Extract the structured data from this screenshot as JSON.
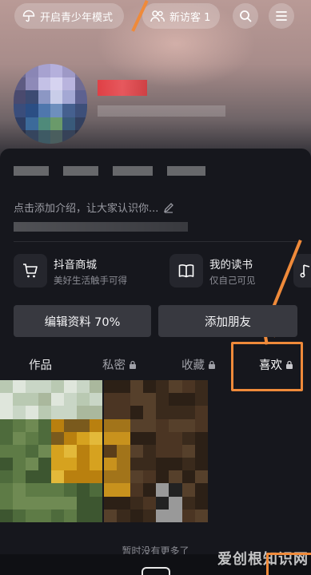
{
  "header": {
    "teen_mode_label": "开启青少年模式",
    "visitor_label": "新访客 1"
  },
  "bio": {
    "placeholder": "点击添加介绍，让大家认识你..."
  },
  "shortcuts": [
    {
      "title": "抖音商城",
      "subtitle": "美好生活触手可得",
      "icon": "cart-icon"
    },
    {
      "title": "我的读书",
      "subtitle": "仅自己可见",
      "icon": "book-icon"
    }
  ],
  "actions": {
    "edit_label": "编辑资料 70%",
    "add_friend_label": "添加朋友"
  },
  "tabs": [
    {
      "label": "作品",
      "locked": false
    },
    {
      "label": "私密",
      "locked": true
    },
    {
      "label": "收藏",
      "locked": true
    },
    {
      "label": "喜欢",
      "locked": true
    }
  ],
  "feed": {
    "end_message": "暂时没有更多了"
  },
  "watermark": "爱创根知识网",
  "colors": {
    "annotation": "#ef8a3a",
    "panel": "#16171d",
    "button": "#383940"
  }
}
